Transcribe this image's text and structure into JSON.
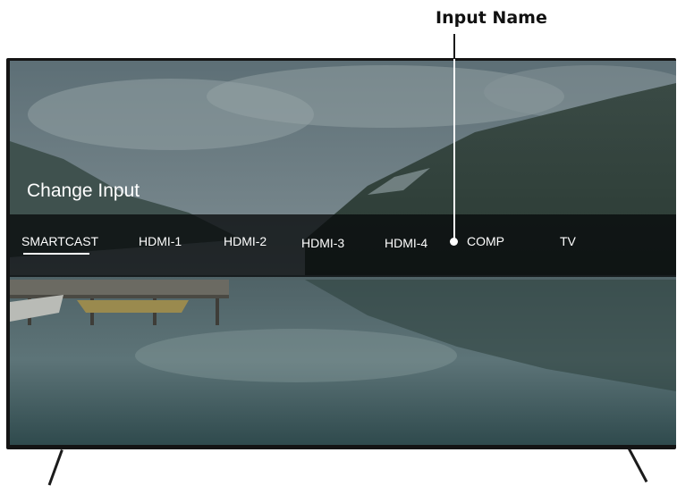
{
  "callout": {
    "label": "Input Name"
  },
  "screen": {
    "title": "Change Input",
    "inputs": [
      "SMARTCAST",
      "HDMI-1",
      "HDMI-2",
      "HDMI-3",
      "HDMI-4",
      "COMP",
      "TV"
    ],
    "selected_input": "SMARTCAST"
  },
  "colors": {
    "text": "#ffffff",
    "bar_background": "#080a0c",
    "bezel": "#141414"
  }
}
